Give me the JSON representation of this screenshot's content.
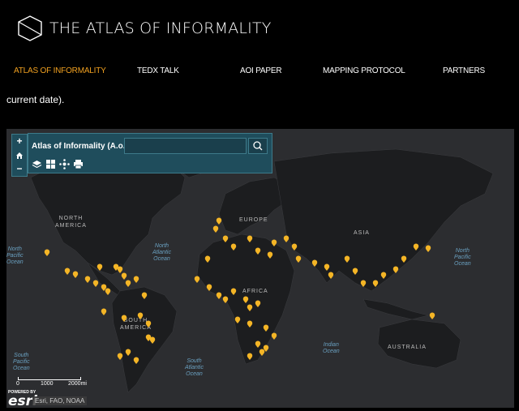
{
  "site": {
    "title": "THE ATLAS OF INFORMALITY",
    "logo_icon": "cube-outline-icon"
  },
  "nav": {
    "items": [
      {
        "label": "ATLAS OF INFORMALITY",
        "active": true
      },
      {
        "label": "TEDX TALK"
      },
      {
        "label": "AOI PAPER"
      },
      {
        "label": "MAPPING PROTOCOL"
      },
      {
        "label": "PARTNERS"
      }
    ]
  },
  "intro_text": "current date).",
  "map": {
    "toolbar_title": "Atlas of Informality (A.o.I)",
    "search_value": "",
    "search_icon": "search-icon",
    "zoom_in": "+",
    "home_icon": "home-icon",
    "zoom_out": "−",
    "tools": [
      "layers-icon",
      "basemap-icon",
      "share-icon",
      "print-icon"
    ],
    "continents": [
      "NORTH AMERICA",
      "EUROPE",
      "ASIA",
      "AFRICA",
      "SOUTH AMERICA",
      "AUSTRALIA"
    ],
    "oceans": [
      "North Atlantic Ocean",
      "North Pacific Ocean",
      "North Pacific Ocean",
      "South Pacific Ocean",
      "South Atlantic Ocean",
      "Indian Ocean"
    ],
    "scale": {
      "labels": [
        "0",
        "1000",
        "2000mi"
      ]
    },
    "attribution": "Esri, FAO, NOAA",
    "esri_powered": "POWERED BY",
    "esri_word": "esri",
    "marker_color": "#f4b526",
    "land_color": "#1c1d1f",
    "water_color": "#2c2d30"
  }
}
